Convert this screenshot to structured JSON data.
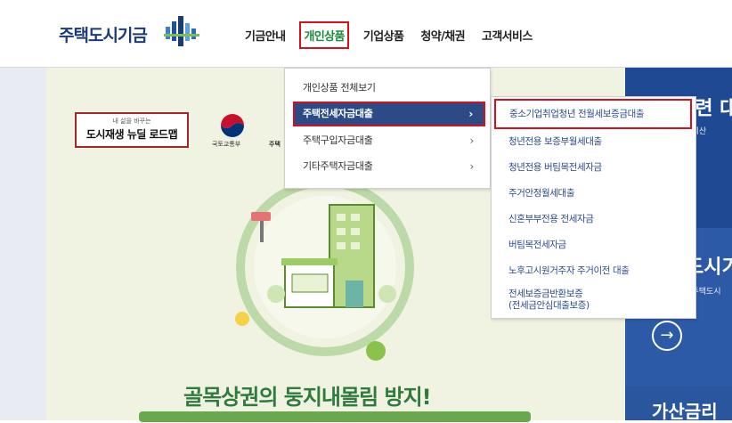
{
  "header": {
    "logo_text": "주택도시기금",
    "nav": [
      {
        "label": "기금안내"
      },
      {
        "label": "개인상품"
      },
      {
        "label": "기업상품"
      },
      {
        "label": "청약/채권"
      },
      {
        "label": "고객서비스"
      }
    ]
  },
  "banner": {
    "badge_small": "내 삶을 바꾸는",
    "badge_main": "도시재생 뉴딜 로드맵",
    "ministry": "국토교통부",
    "ministry2": "주택",
    "title": "골목상권의 둥지내몰림 방지!"
  },
  "right_panel": {
    "text1": "관련 대",
    "sub1": "가점계산",
    "text2": "도시기",
    "sub2": "! 주택도시",
    "arrow": "→",
    "text3": "가산금리"
  },
  "dropdown": {
    "items": [
      {
        "label": "개인상품 전체보기",
        "chevron": ""
      },
      {
        "label": "주택전세자금대출",
        "chevron": "›"
      },
      {
        "label": "주택구입자금대출",
        "chevron": "›"
      },
      {
        "label": "기타주택자금대출",
        "chevron": "›"
      }
    ]
  },
  "submenu": {
    "items": [
      {
        "label": "중소기업취업청년 전월세보증금대출"
      },
      {
        "label": "청년전용 보증부월세대출"
      },
      {
        "label": "청년전용 버팀목전세자금"
      },
      {
        "label": "주거안정월세대출"
      },
      {
        "label": "신혼부부전용 전세자금"
      },
      {
        "label": "버팀목전세자금"
      },
      {
        "label": "노후고시원거주자 주거이전 대출"
      },
      {
        "label": "전세보증금반환보증",
        "line2": "(전세금안심대출보증)"
      }
    ]
  },
  "colors": {
    "accent_green": "#1c8a3a",
    "highlight_red": "#d7101d",
    "menu_blue": "#2c4a86",
    "panel_blue": "#1f4a93"
  }
}
